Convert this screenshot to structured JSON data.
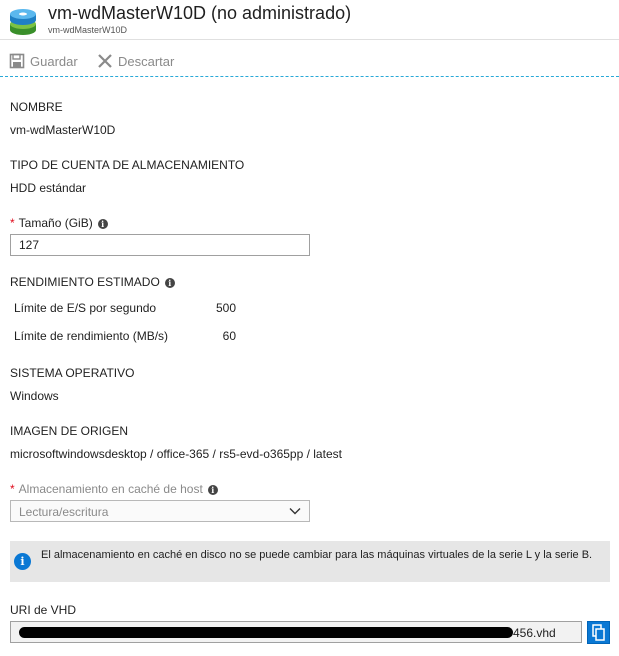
{
  "header": {
    "title": "vm-wdMasterW10D (no administrado)",
    "subtitle": "vm-wdMasterW10D",
    "icon": "disk-icon"
  },
  "toolbar": {
    "save_label": "Guardar",
    "save_icon": "save-icon",
    "discard_label": "Descartar",
    "discard_icon": "close-icon"
  },
  "fields": {
    "name_label": "NOMBRE",
    "name_value": "vm-wdMasterW10D",
    "account_type_label": "TIPO DE CUENTA DE ALMACENAMIENTO",
    "account_type_value": "HDD estándar",
    "size_required": "*",
    "size_label": "Tamaño (GiB)",
    "size_value": "127",
    "perf_label": "RENDIMIENTO ESTIMADO",
    "perf_rows": [
      {
        "label": "Límite de E/S por segundo",
        "value": "500"
      },
      {
        "label": "Límite de rendimiento (MB/s)",
        "value": "60"
      }
    ],
    "os_label": "SISTEMA OPERATIVO",
    "os_value": "Windows",
    "source_label": "IMAGEN DE ORIGEN",
    "source_value": "microsoftwindowsdesktop / office-365 / rs5-evd-o365pp / latest",
    "cache_required": "*",
    "cache_label": "Almacenamiento en caché de host",
    "cache_value": "Lectura/escritura",
    "info_message": "El almacenamiento en caché en disco no se puede cambiar para las máquinas virtuales de la serie L y la serie B.",
    "uri_label": "URI de VHD",
    "uri_visible_suffix": "456.vhd"
  },
  "colors": {
    "accent": "#0a78d4",
    "required": "#e00b1c",
    "toolbar_divider": "#2aa9d8"
  }
}
